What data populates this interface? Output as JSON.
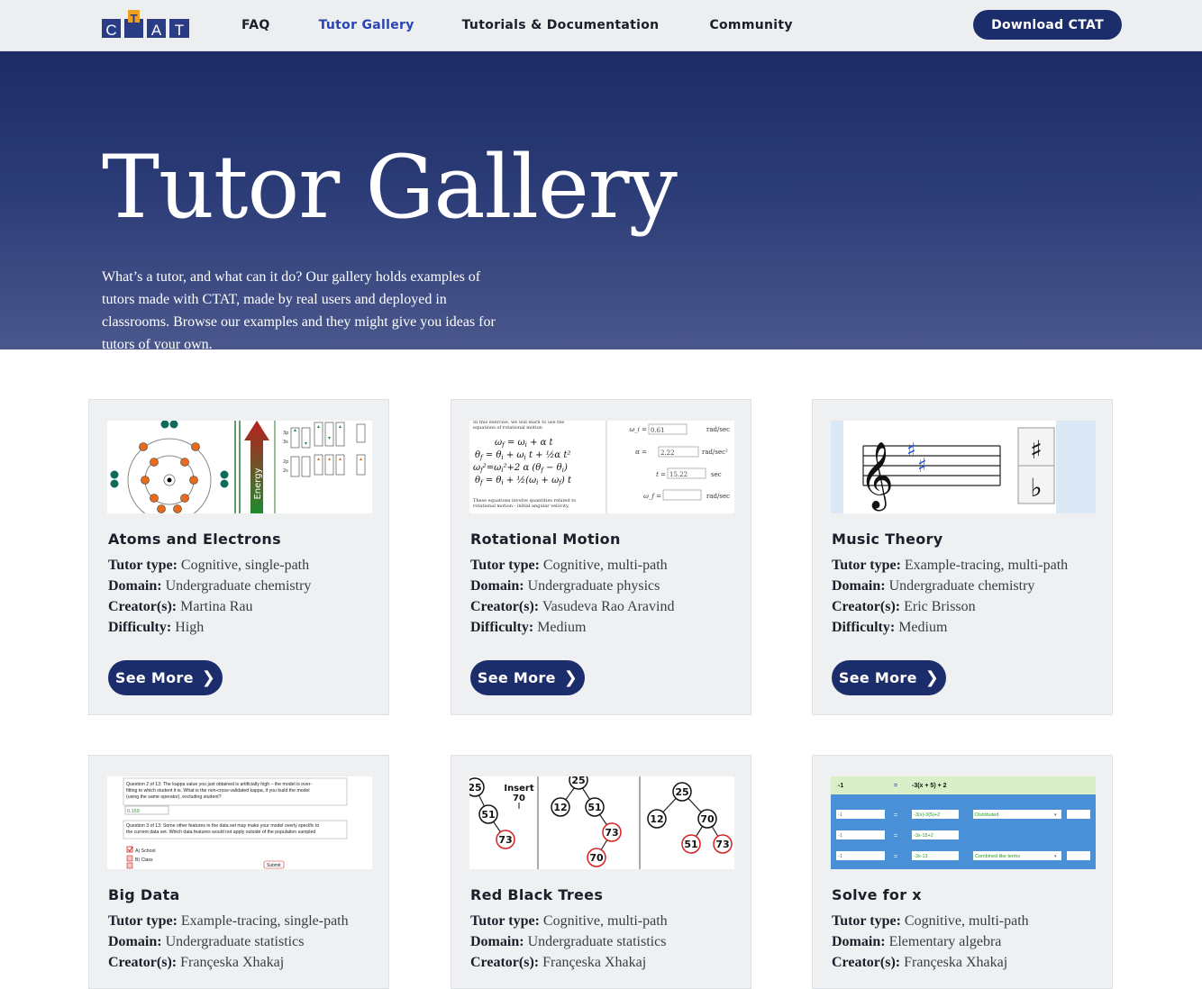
{
  "nav": {
    "logo_text": "CTAT",
    "links": [
      {
        "label": "FAQ",
        "active": false
      },
      {
        "label": "Tutor Gallery",
        "active": true
      },
      {
        "label": "Tutorials & Documentation",
        "active": false
      },
      {
        "label": "Community",
        "active": false
      }
    ],
    "download_label": "Download CTAT"
  },
  "hero": {
    "title": "Tutor Gallery",
    "intro": "What’s a tutor, and what can it do? Our gallery holds examples of tutors made with CTAT, made by real users and deployed in classrooms. Browse our examples and they might give you ideas for tutors of your own."
  },
  "labels": {
    "tutor_type": "Tutor type:",
    "domain": "Domain:",
    "creators": "Creator(s):",
    "difficulty": "Difficulty:",
    "see_more": "See More"
  },
  "cards": [
    {
      "title": "Atoms and Electrons",
      "tutor_type": "Cognitive, single-path",
      "domain": "Undergraduate chemistry",
      "creators": "Martina Rau",
      "difficulty": "High",
      "thumb_text": "Energy"
    },
    {
      "title": "Rotational Motion",
      "tutor_type": "Cognitive, multi-path",
      "domain": "Undergraduate physics",
      "creators": "Vasudeva Rao Aravind",
      "difficulty": "Medium",
      "thumb_inputs": [
        "0.61",
        "2.22",
        "15.22",
        ""
      ],
      "thumb_units": [
        "rad/sec",
        "rad/sec²",
        "sec",
        "rad/sec"
      ],
      "thumb_vars": [
        "ω_i =",
        "α =",
        "t =",
        "ω_f ="
      ]
    },
    {
      "title": "Music Theory",
      "tutor_type": "Example-tracing, multi-path",
      "domain": "Undergraduate chemistry",
      "creators": "Eric Brisson",
      "difficulty": "Medium"
    },
    {
      "title": "Big Data",
      "tutor_type": "Example-tracing, single-path",
      "domain": "Undergraduate statistics",
      "creators": "Françeska Xhakaj",
      "thumb_lines": [
        "Question 2 of 13: The kappa value you just obtained is artificially high – the model is over-",
        "fitting to which student it is. What is the non-cross-validated kappa, if you build the model",
        "(using the same operator), excluding student?",
        "0.159",
        "Question 3 of 13: Some other features in the data set may make your model overly specific to",
        "the current data set. Which data features would not apply outside of the population sampled",
        "A) School",
        "B) Class",
        "Submit"
      ]
    },
    {
      "title": "Red Black Trees",
      "tutor_type": "Cognitive, multi-path",
      "domain": "Undergraduate statistics",
      "creators": "Françeska Xhakaj",
      "thumb_insert": "Insert",
      "thumb_insert_val": "70"
    },
    {
      "title": "Solve for x",
      "tutor_type": "Cognitive, multi-path",
      "domain": "Elementary algebra",
      "creators": "Françeska Xhakaj",
      "thumb_rows": [
        [
          "-1",
          "=",
          "-3(x + 5) + 2"
        ],
        [
          "-1",
          "=",
          "-3(x)-3(5)+2",
          "Distributed"
        ],
        [
          "-1",
          "=",
          "-3x-15+2",
          ""
        ],
        [
          "-1",
          "=",
          "-3x-13",
          "Combined like terms"
        ]
      ]
    }
  ]
}
